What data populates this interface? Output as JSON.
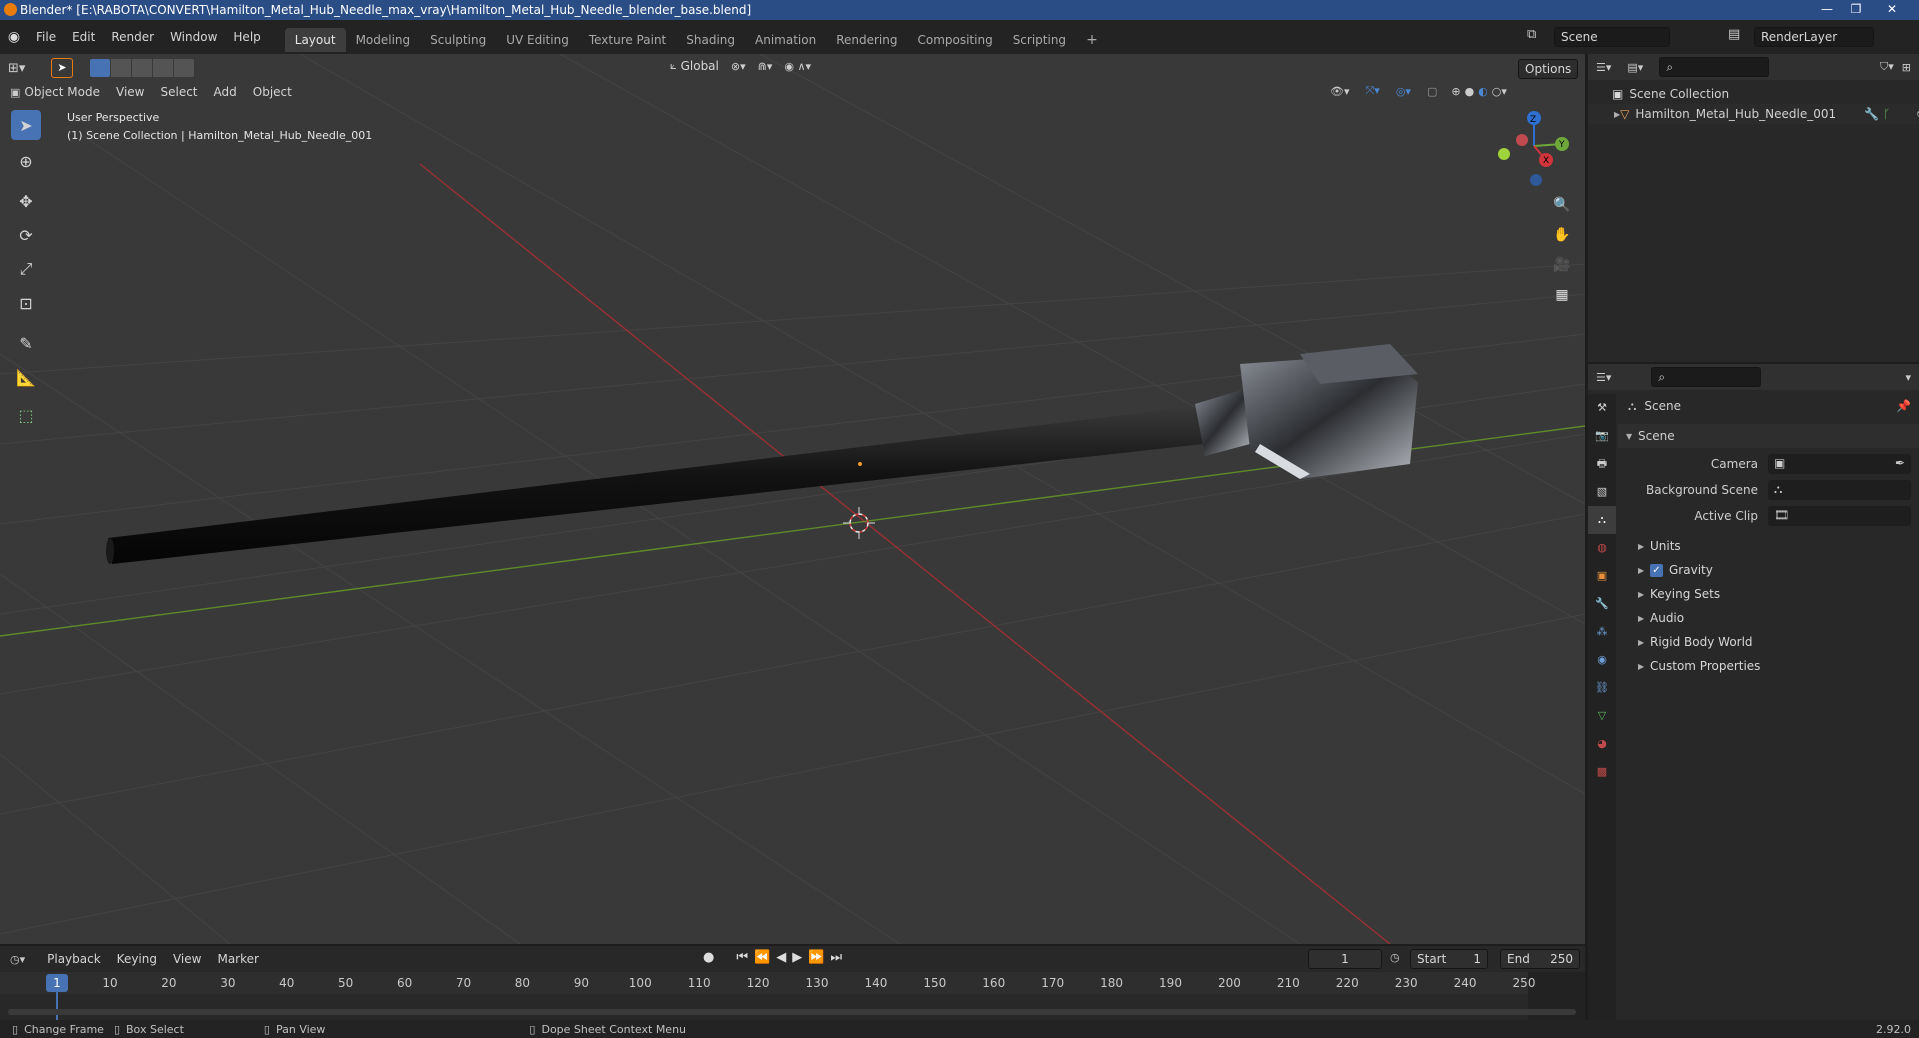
{
  "window": {
    "title": "Blender* [E:\\RABOTA\\CONVERT\\Hamilton_Metal_Hub_Needle_max_vray\\Hamilton_Metal_Hub_Needle_blender_base.blend]",
    "minimize": "—",
    "maximize": "❐",
    "close": "✕"
  },
  "menu": {
    "items": [
      "File",
      "Edit",
      "Render",
      "Window",
      "Help"
    ]
  },
  "workspaces": [
    "Layout",
    "Modeling",
    "Sculpting",
    "UV Editing",
    "Texture Paint",
    "Shading",
    "Animation",
    "Rendering",
    "Compositing",
    "Scripting"
  ],
  "scene_selector": {
    "value": "Scene"
  },
  "render_layer": {
    "value": "RenderLayer"
  },
  "viewport": {
    "mode": "Object Mode",
    "menus": [
      "View",
      "Select",
      "Add",
      "Object"
    ],
    "orientation": "Global",
    "options_label": "Options",
    "overlay_title": "User Perspective",
    "overlay_subtitle": "(1) Scene Collection | Hamilton_Metal_Hub_Needle_001",
    "gizmo": {
      "z": "Z",
      "y": "Y",
      "x": "X"
    }
  },
  "outliner": {
    "root": "Scene Collection",
    "object": "Hamilton_Metal_Hub_Needle_001"
  },
  "properties": {
    "header": "Scene",
    "panel": "Scene",
    "fields": [
      {
        "label": "Camera"
      },
      {
        "label": "Background Scene"
      },
      {
        "label": "Active Clip"
      }
    ],
    "subpanels": [
      "Units",
      "Gravity",
      "Keying Sets",
      "Audio",
      "Rigid Body World",
      "Custom Properties"
    ],
    "gravity_checked": true
  },
  "timeline": {
    "menus": [
      "Playback",
      "Keying",
      "View",
      "Marker"
    ],
    "current_frame": "1",
    "start_label": "Start",
    "start_value": "1",
    "end_label": "End",
    "end_value": "250",
    "ticks": [
      "1",
      "10",
      "20",
      "30",
      "40",
      "50",
      "60",
      "70",
      "80",
      "90",
      "100",
      "110",
      "120",
      "130",
      "140",
      "150",
      "160",
      "170",
      "180",
      "190",
      "200",
      "210",
      "220",
      "230",
      "240",
      "250"
    ]
  },
  "statusbar": {
    "items": [
      "Change Frame",
      "Box Select",
      "Pan View",
      "Dope Sheet Context Menu"
    ],
    "version": "2.92.0"
  }
}
